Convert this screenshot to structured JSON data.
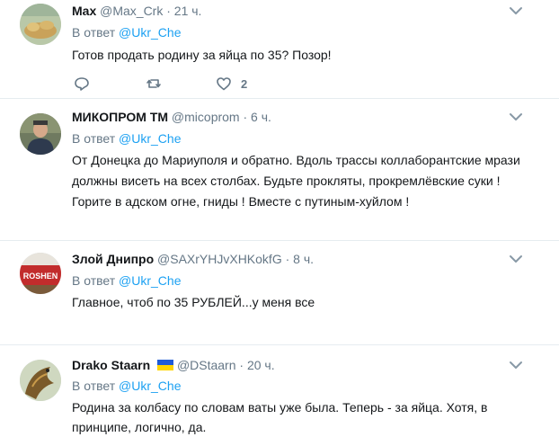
{
  "tweets": [
    {
      "name": "Max",
      "handle": "@Max_Crk",
      "dot": "·",
      "time": "21 ч.",
      "reply_prefix": "В ответ",
      "reply_to": "@Ukr_Che",
      "text": "Готов продать родину за яйца по 35? Позор!",
      "like_count": "2"
    },
    {
      "name": "МИКОПРОМ ТМ",
      "handle": "@micoprom",
      "dot": "·",
      "time": "6 ч.",
      "reply_prefix": "В ответ",
      "reply_to": "@Ukr_Che",
      "text": "От Донецка до Мариуполя и обратно. Вдоль трассы коллаборантские мрази должны висеть на всех столбах. Будьте прокляты, прокремлёвские суки ! Горите в адском огне, гниды ! Вместе с путиным-хуйлом !"
    },
    {
      "name": "Злой Днипро",
      "handle": "@SAXrYHJvXHKokfG",
      "dot": "·",
      "time": "8 ч.",
      "reply_prefix": "В ответ",
      "reply_to": "@Ukr_Che",
      "text": "Главное, чтоб по 35 РУБЛЕЙ...у меня все",
      "avatar_text": "ROSHEN"
    },
    {
      "name": "Drako Staarn",
      "handle": "@DStaarn",
      "dot": "·",
      "time": "20 ч.",
      "reply_prefix": "В ответ",
      "reply_to": "@Ukr_Che",
      "text": "Родина за колбасу по словам ваты уже была. Теперь - за яйца. Хотя, в принципе, логично, да."
    }
  ],
  "colors": {
    "link": "#1da1f2",
    "muted": "#657786",
    "divider": "#e6ecf0",
    "flag_blue": "#1f5bd8",
    "flag_yellow": "#ffd500"
  }
}
